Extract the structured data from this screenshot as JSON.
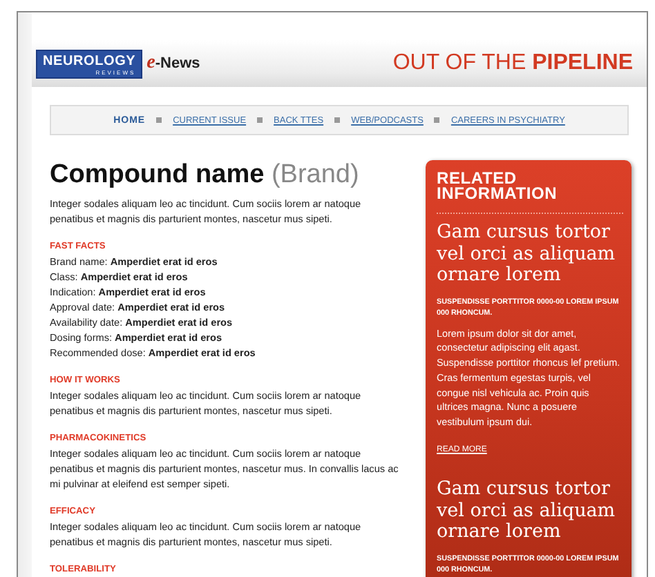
{
  "header": {
    "logo": {
      "name": "NEUROLOGY",
      "sub": "REVIEWS"
    },
    "product": {
      "prefix": "e",
      "name": "-News"
    },
    "title": "OUT OF THE **PIPELINE**"
  },
  "nav": [
    {
      "label": "HOME",
      "selected": true
    },
    {
      "label": "CURRENT ISSUE",
      "selected": false
    },
    {
      "label": "BACK TTES",
      "selected": false
    },
    {
      "label": "WEB/PODCASTS",
      "selected": false
    },
    {
      "label": "CAREERS IN PSYCHIATRY",
      "selected": false
    }
  ],
  "article": {
    "title": "Compound name",
    "brand": "(Brand)",
    "intro": "Integer sodales aliquam leo ac tincidunt. Cum sociis lorem ar natoque penatibus et magnis dis parturient montes, nascetur mus sipeti.",
    "fast_facts": {
      "heading": "FAST FACTS",
      "items": [
        {
          "label": "Brand name:",
          "value": "Amperdiet erat id eros"
        },
        {
          "label": "Class:",
          "value": "Amperdiet erat id eros"
        },
        {
          "label": "Indication:",
          "value": "Amperdiet erat id eros"
        },
        {
          "label": "Approval date:",
          "value": "Amperdiet erat id eros"
        },
        {
          "label": "Availability date:",
          "value": "Amperdiet erat id eros"
        },
        {
          "label": "Dosing forms:",
          "value": "Amperdiet erat id eros"
        },
        {
          "label": "Recommended dose:",
          "value": "Amperdiet erat id eros"
        }
      ]
    },
    "sections": [
      {
        "heading": "HOW IT WORKS",
        "body": "Integer sodales aliquam leo ac tincidunt. Cum sociis lorem ar natoque penatibus et magnis dis parturient montes, nascetur mus sipeti."
      },
      {
        "heading": "PHARMACOKINETICS",
        "body": "Integer sodales aliquam leo ac tincidunt. Cum sociis lorem ar natoque penatibus et magnis dis parturient montes, nascetur mus. In convallis lacus ac mi pulvinar at eleifend est semper sipeti."
      },
      {
        "heading": "EFFICACY",
        "body": "Integer sodales aliquam leo ac tincidunt. Cum sociis lorem ar natoque penatibus et magnis dis parturient montes, nascetur mus sipeti."
      },
      {
        "heading": "TOLERABILITY"
      }
    ]
  },
  "sidebar": {
    "heading": "RELATED INFORMATION",
    "items": [
      {
        "title": "Gam cursus tortor vel orci as aliquam ornare lorem",
        "meta": "SUSPENDISSE PORTTITOR 0000-00 LOREM IPSUM 000 RHONCUM.",
        "body": "Lorem ipsum dolor sit dor amet, consectetur adipiscing elit agast. Suspendisse porttitor rhoncus lef pretium. Cras fermentum egestas turpis, vel congue nisl vehicula ac. Proin quis ultrices magna. Nunc a posuere vestibulum ipsum dui.",
        "link": "READ MORE"
      },
      {
        "title": "Gam cursus tortor vel orci as aliquam ornare lorem",
        "meta": "SUSPENDISSE PORTTITOR 0000-00 LOREM IPSUM 000 RHONCUM."
      }
    ]
  }
}
